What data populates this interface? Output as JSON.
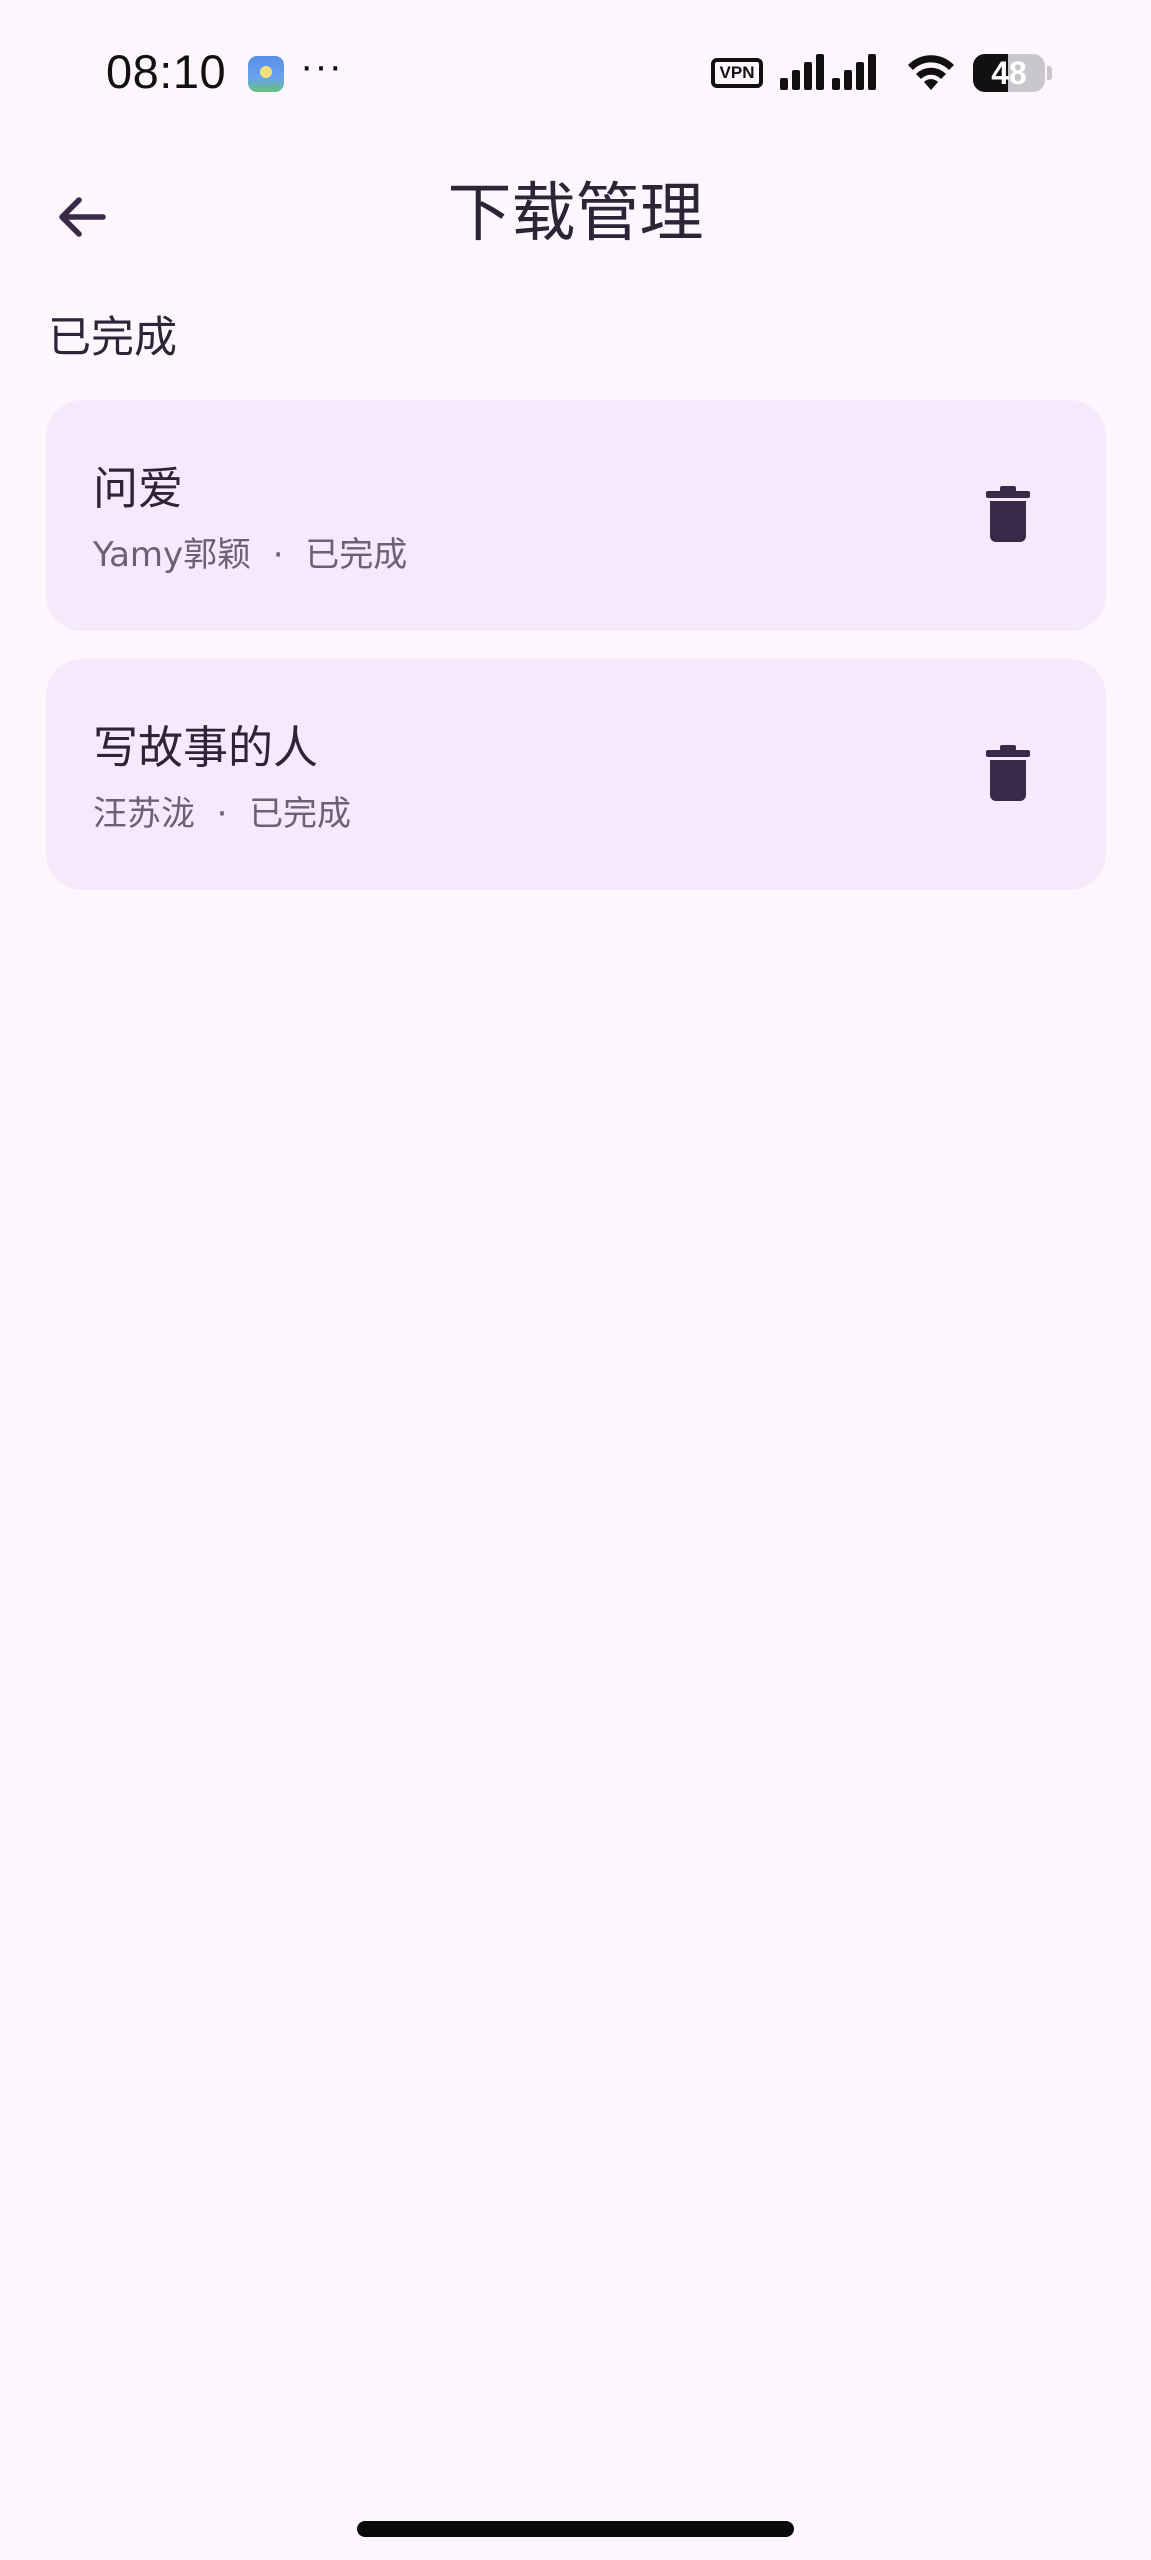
{
  "status_bar": {
    "time": "08:10",
    "notification_icon": "app-notification-icon",
    "more_indicator": "···",
    "vpn_label": "VPN",
    "battery_level": "48",
    "battery_fraction": 0.48
  },
  "app_bar": {
    "back_icon": "arrow-left-icon",
    "title": "下载管理"
  },
  "section": {
    "title": "已完成"
  },
  "downloads": [
    {
      "title": "问爱",
      "artist": "Yamy郭颖",
      "separator": "·",
      "status": "已完成",
      "delete_icon": "trash-icon"
    },
    {
      "title": "写故事的人",
      "artist": "汪苏泷",
      "separator": "·",
      "status": "已完成",
      "delete_icon": "trash-icon"
    }
  ],
  "colors": {
    "background": "#fdf7fd",
    "card": "#f5e9fb",
    "text_primary": "#2f2338",
    "text_secondary": "#6c6173",
    "icon": "#3a2a47"
  }
}
